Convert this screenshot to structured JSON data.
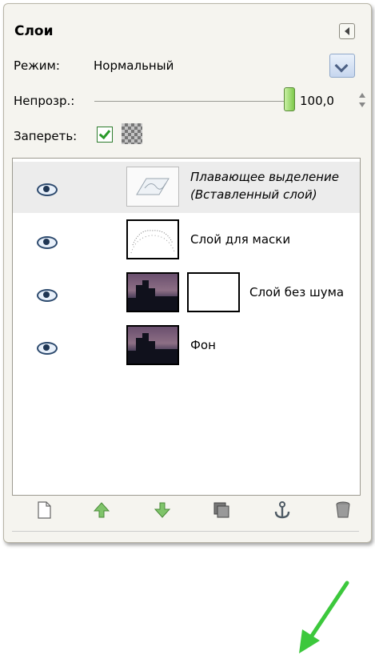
{
  "panel": {
    "title": "Слои",
    "mode_label": "Режим:",
    "mode_value": "Нормальный",
    "opacity_label": "Непрозр.:",
    "opacity_value": "100,0",
    "opacity_level": 1.0,
    "lock_label": "Запереть:"
  },
  "layers": [
    {
      "name_line1": "Плавающее выделение",
      "name_line2": "(Вставленный слой)"
    },
    {
      "name": "Слой для маски"
    },
    {
      "name": "Слой без шума"
    },
    {
      "name": "Фон"
    }
  ],
  "colors": {
    "arrow": "#3cc83c",
    "opacity_handle": "#7ec94c",
    "selected_row": "#ececec"
  },
  "icons": [
    "new-layer-icon",
    "raise-layer-icon",
    "lower-layer-icon",
    "duplicate-layer-icon",
    "anchor-icon",
    "delete-layer-icon"
  ]
}
